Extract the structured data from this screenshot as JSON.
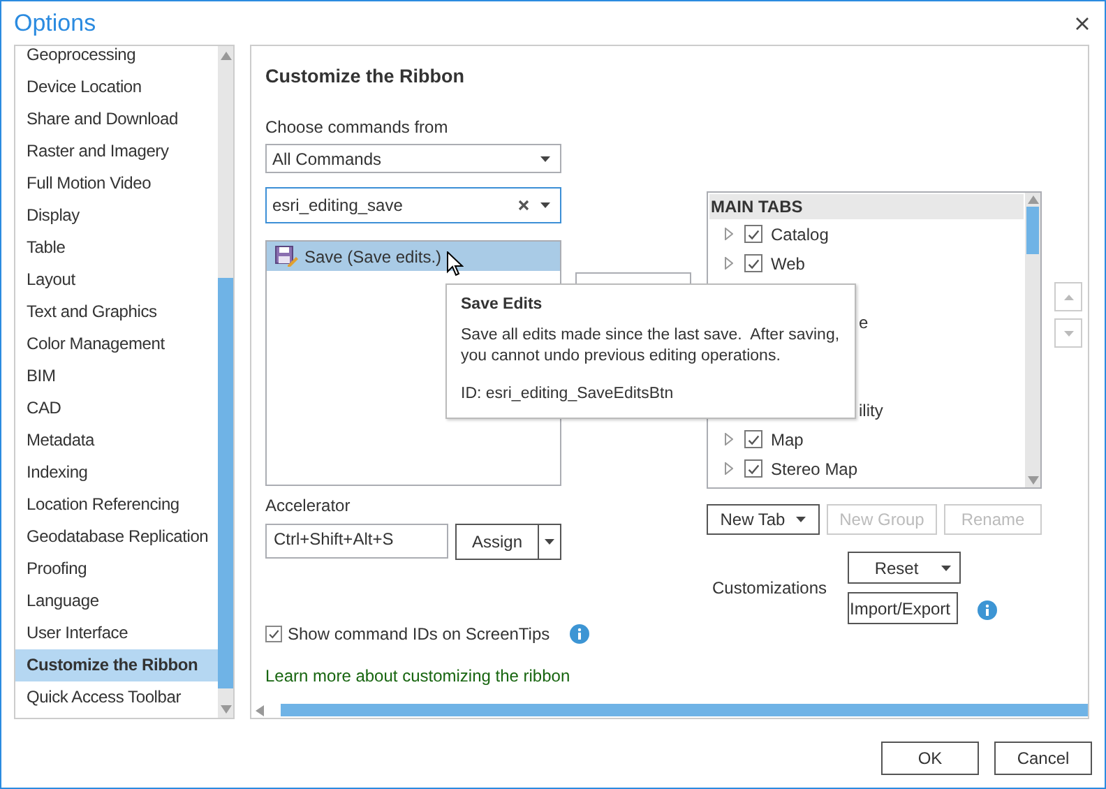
{
  "window": {
    "title": "Options"
  },
  "sidebar": {
    "items": [
      {
        "label": "Geoprocessing",
        "selected": false
      },
      {
        "label": "Device Location",
        "selected": false
      },
      {
        "label": "Share and Download",
        "selected": false
      },
      {
        "label": "Raster and Imagery",
        "selected": false
      },
      {
        "label": "Full Motion Video",
        "selected": false
      },
      {
        "label": "Display",
        "selected": false
      },
      {
        "label": "Table",
        "selected": false
      },
      {
        "label": "Layout",
        "selected": false
      },
      {
        "label": "Text and Graphics",
        "selected": false
      },
      {
        "label": "Color Management",
        "selected": false
      },
      {
        "label": "BIM",
        "selected": false
      },
      {
        "label": "CAD",
        "selected": false
      },
      {
        "label": "Metadata",
        "selected": false
      },
      {
        "label": "Indexing",
        "selected": false
      },
      {
        "label": "Location Referencing",
        "selected": false
      },
      {
        "label": "Geodatabase Replication",
        "selected": false
      },
      {
        "label": "Proofing",
        "selected": false
      },
      {
        "label": "Language",
        "selected": false
      },
      {
        "label": "User Interface",
        "selected": false
      },
      {
        "label": "Customize the Ribbon",
        "selected": true
      },
      {
        "label": "Quick Access Toolbar",
        "selected": false
      }
    ]
  },
  "panel": {
    "heading": "Customize the Ribbon",
    "commands_label": "Choose commands from",
    "commands_dropdown": {
      "value": "All Commands"
    },
    "search": {
      "value": "esri_editing_save"
    },
    "command_list": [
      {
        "label": "Save (Save edits.)",
        "selected": true
      }
    ],
    "accelerator": {
      "label": "Accelerator",
      "value": "Ctrl+Shift+Alt+S",
      "button": "Assign"
    },
    "show_ids": {
      "label": "Show command IDs on ScreenTips",
      "checked": true
    },
    "link": "Learn more about customizing the ribbon",
    "tree": {
      "header": "MAIN TABS",
      "rows": [
        {
          "kind": "tab",
          "label": "Catalog",
          "checked": true
        },
        {
          "kind": "tab",
          "label": "Web",
          "checked": true
        },
        {
          "kind": "covered"
        },
        {
          "kind": "covered",
          "label": "e"
        },
        {
          "kind": "covered"
        },
        {
          "kind": "covered"
        },
        {
          "kind": "covered",
          "label": "ility"
        },
        {
          "kind": "tab",
          "label": "Map",
          "checked": true
        },
        {
          "kind": "tab",
          "label": "Stereo Map",
          "checked": true
        }
      ]
    },
    "tree_buttons": [
      {
        "label": "New Tab",
        "disabled": false,
        "dropdown": true
      },
      {
        "label": "New Group",
        "disabled": true,
        "dropdown": false
      },
      {
        "label": "Rename",
        "disabled": true,
        "dropdown": false
      }
    ],
    "customizations": {
      "label": "Customizations",
      "buttons": [
        "Reset",
        "Import/Export"
      ]
    }
  },
  "tooltip": {
    "title": "Save Edits",
    "lines": [
      "Save all edits made since the last save.  After saving,",
      "you cannot undo previous editing operations."
    ],
    "id": "ID: esri_editing_SaveEditsBtn"
  },
  "buttons": [
    "OK",
    "Cancel"
  ]
}
